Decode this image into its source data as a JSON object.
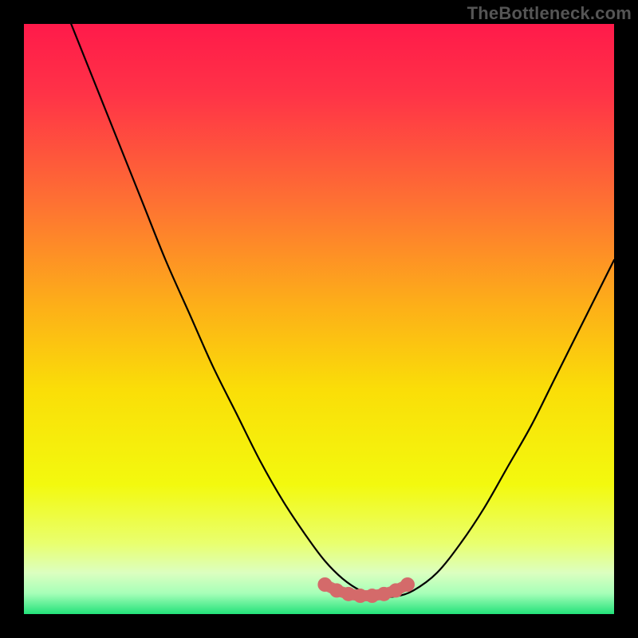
{
  "watermark": "TheBottleneck.com",
  "colors": {
    "background": "#000000",
    "gradient_stops": [
      {
        "offset": 0.0,
        "color": "#ff1a4a"
      },
      {
        "offset": 0.12,
        "color": "#ff3347"
      },
      {
        "offset": 0.3,
        "color": "#fe7033"
      },
      {
        "offset": 0.48,
        "color": "#fdb018"
      },
      {
        "offset": 0.62,
        "color": "#fade08"
      },
      {
        "offset": 0.78,
        "color": "#f3f90e"
      },
      {
        "offset": 0.88,
        "color": "#e9ff6e"
      },
      {
        "offset": 0.93,
        "color": "#dcffc0"
      },
      {
        "offset": 0.965,
        "color": "#a6ffb8"
      },
      {
        "offset": 1.0,
        "color": "#23e27a"
      }
    ],
    "curve": "#000000",
    "marker": "#d46a6a"
  },
  "chart_data": {
    "type": "line",
    "title": "",
    "xlabel": "",
    "ylabel": "",
    "xlim": [
      0,
      100
    ],
    "ylim": [
      0,
      100
    ],
    "series": [
      {
        "name": "bottleneck-curve",
        "x": [
          8,
          12,
          16,
          20,
          24,
          28,
          32,
          36,
          40,
          44,
          48,
          51,
          54,
          57,
          60,
          63,
          66,
          70,
          74,
          78,
          82,
          86,
          90,
          94,
          98,
          100
        ],
        "y": [
          100,
          90,
          80,
          70,
          60,
          51,
          42,
          34,
          26,
          19,
          13,
          9,
          6,
          4,
          3,
          3,
          4,
          7,
          12,
          18,
          25,
          32,
          40,
          48,
          56,
          60
        ]
      }
    ],
    "markers": {
      "name": "optimal-range",
      "x": [
        51,
        53,
        55,
        57,
        59,
        61,
        63,
        65
      ],
      "y": [
        5,
        4,
        3.4,
        3.1,
        3.1,
        3.4,
        4,
        5
      ]
    }
  }
}
